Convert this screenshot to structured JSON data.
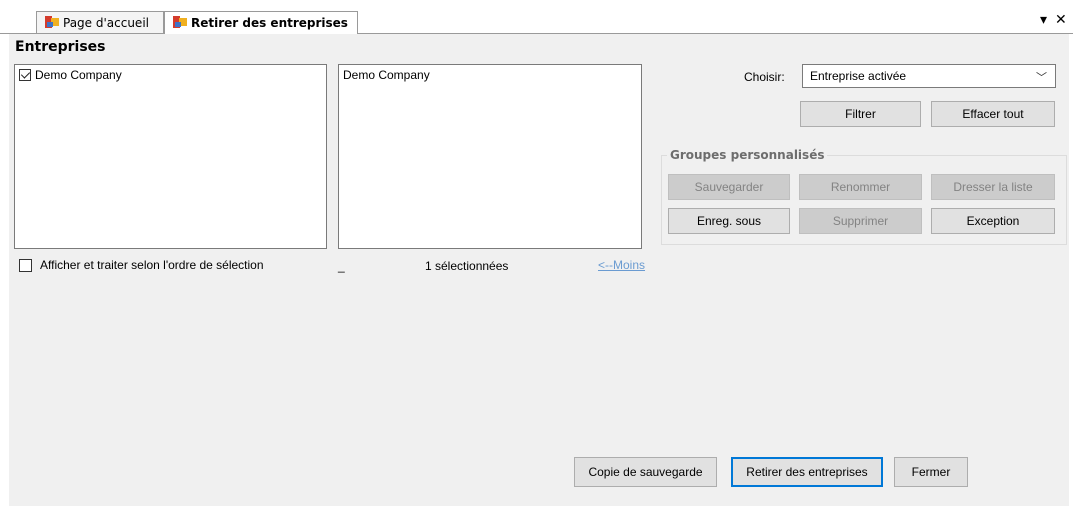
{
  "tabs": [
    {
      "label": "Page d'accueil"
    },
    {
      "label": "Retirer des entreprises"
    }
  ],
  "window_controls": {
    "dropdown_glyph": "▾",
    "close_glyph": "✕"
  },
  "section": {
    "title": "Entreprises"
  },
  "left_list": {
    "items": [
      {
        "label": "Demo Company",
        "checked": true
      }
    ]
  },
  "right_list": {
    "items": [
      {
        "label": "Demo Company"
      }
    ]
  },
  "order_checkbox": {
    "label": "Afficher et traiter selon l'ordre de sélection",
    "checked": false
  },
  "status": {
    "dash": "_",
    "selected_text": "1 sélectionnées",
    "less_link": "<--Moins"
  },
  "choose": {
    "label": "Choisir:",
    "value": "Entreprise activée"
  },
  "filter_buttons": {
    "filter": "Filtrer",
    "clear_all": "Effacer tout"
  },
  "custom_groups": {
    "title": "Groupes personnalisés",
    "save": "Sauvegarder",
    "rename": "Renommer",
    "make_list": "Dresser la liste",
    "save_as": "Enreg. sous",
    "delete": "Supprimer",
    "exception": "Exception"
  },
  "footer": {
    "backup": "Copie de sauvegarde",
    "remove": "Retirer des entreprises",
    "close": "Fermer"
  }
}
